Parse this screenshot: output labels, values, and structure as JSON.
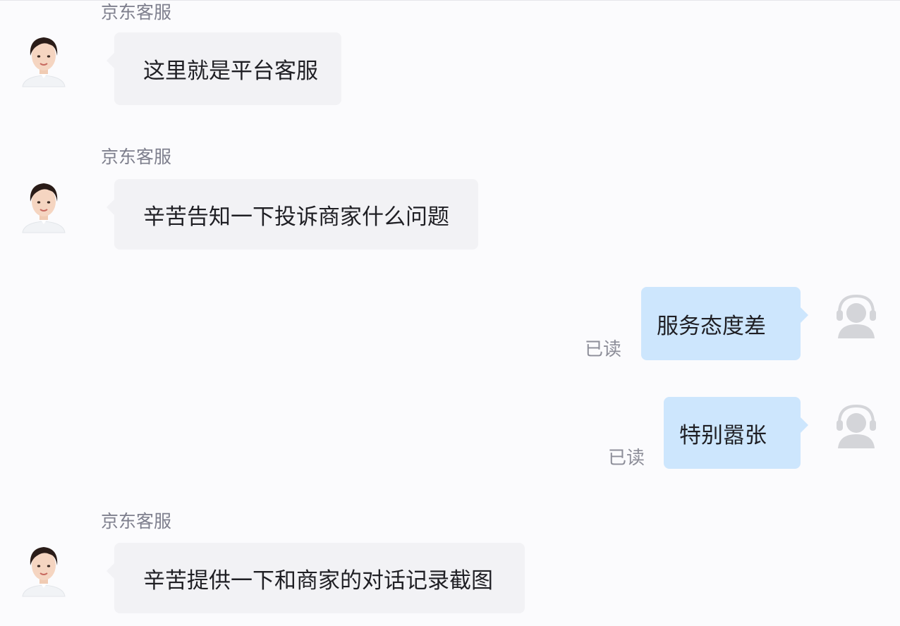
{
  "messages": [
    {
      "sender": "京东客服",
      "text": "这里就是平台客服",
      "direction": "incoming"
    },
    {
      "sender": "京东客服",
      "text": "辛苦告知一下投诉商家什么问题",
      "direction": "incoming"
    },
    {
      "text": "服务态度差",
      "direction": "outgoing",
      "status": "已读"
    },
    {
      "text": "特别嚣张",
      "direction": "outgoing",
      "status": "已读"
    },
    {
      "sender": "京东客服",
      "text": "辛苦提供一下和商家的对话记录截图",
      "direction": "incoming"
    }
  ],
  "colors": {
    "background": "#fbfbfd",
    "incoming_bubble": "#f2f2f5",
    "outgoing_bubble": "#cde6fd",
    "meta_text": "#7e7f8d"
  },
  "icons": {
    "agent_avatar": "agent-avatar-icon",
    "user_avatar": "user-headset-icon"
  }
}
